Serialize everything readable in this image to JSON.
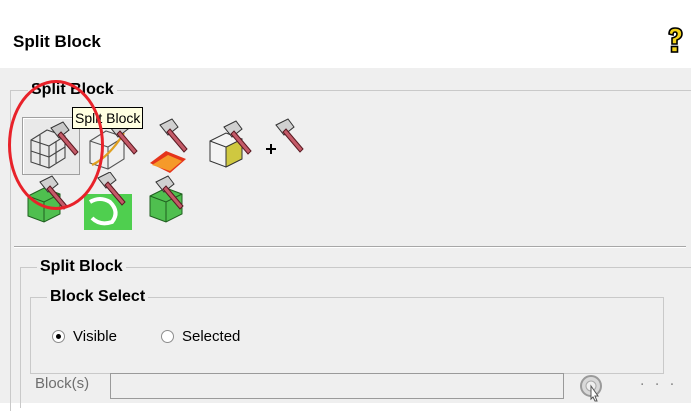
{
  "header": {
    "title": "Split Block",
    "help_icon": "help-question-icon"
  },
  "outer_group": {
    "label": "Split Block"
  },
  "tools": [
    {
      "name": "split-block",
      "icon": "hatchet-wireframe-cube-icon",
      "selected": true
    },
    {
      "name": "split-prescribed-curve",
      "icon": "hatchet-cube-orange-curve-icon"
    },
    {
      "name": "split-face",
      "icon": "hatchet-red-face-icon"
    },
    {
      "name": "split-yellow-block",
      "icon": "hatchet-yellow-cube-icon"
    },
    {
      "name": "split-vertex",
      "icon": "hatchet-vertex-icon"
    },
    {
      "name": "split-green-block",
      "icon": "hatchet-green-cube-icon"
    },
    {
      "name": "split-green-shape",
      "icon": "hatchet-green-shape-icon"
    },
    {
      "name": "split-green-block-2",
      "icon": "hatchet-green-cube-2-icon"
    }
  ],
  "tooltip": {
    "text": "Split Block"
  },
  "colors": {
    "panel_bg": "#efefef",
    "tooltip_bg": "#ffffe1",
    "highlight_circle": "#e8222a"
  },
  "split_group": {
    "label": "Split Block",
    "block_select": {
      "label": "Block Select",
      "options": [
        {
          "label": "Visible",
          "checked": true
        },
        {
          "label": "Selected",
          "checked": false
        }
      ]
    },
    "blocks": {
      "label": "Block(s)",
      "value": "",
      "more": ". . ."
    }
  }
}
